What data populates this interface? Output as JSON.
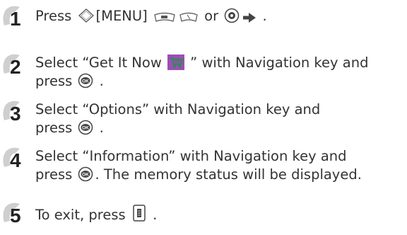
{
  "steps": [
    {
      "number": "1",
      "parts": [
        "Press ",
        "[MENU] ",
        " or ",
        " ."
      ]
    },
    {
      "number": "2",
      "line1_parts": [
        "Select “Get It Now ",
        " ” with Navigation key and"
      ],
      "line2_parts": [
        "press ",
        " ."
      ]
    },
    {
      "number": "3",
      "line1": "Select “Options” with Navigation key and",
      "line2_parts": [
        "press ",
        " ."
      ]
    },
    {
      "number": "4",
      "line1": "Select “Information” with Navigation key and",
      "line2_parts": [
        "press ",
        ". The memory status will be displayed."
      ]
    },
    {
      "number": "5",
      "parts": [
        "To exit, press ",
        " ."
      ]
    }
  ],
  "icons": {
    "nav_key": "navigation-key-icon",
    "menu_soft_key": "left-soft-key-icon",
    "right_soft_key": "right-soft-key-icon",
    "ok_nav": "ok-navigation-key-icon",
    "arrow": "right-arrow-icon",
    "get_it_now": "get-it-now-cart-icon",
    "ok": "ok-key-icon",
    "end": "end-key-icon"
  },
  "colors": {
    "text": "#333333",
    "badge_fill": "#d9d9d9",
    "badge_number": "#222222",
    "get_it_now_bg": "#9b4fb5",
    "get_it_now_cart": "#2e8b57"
  }
}
